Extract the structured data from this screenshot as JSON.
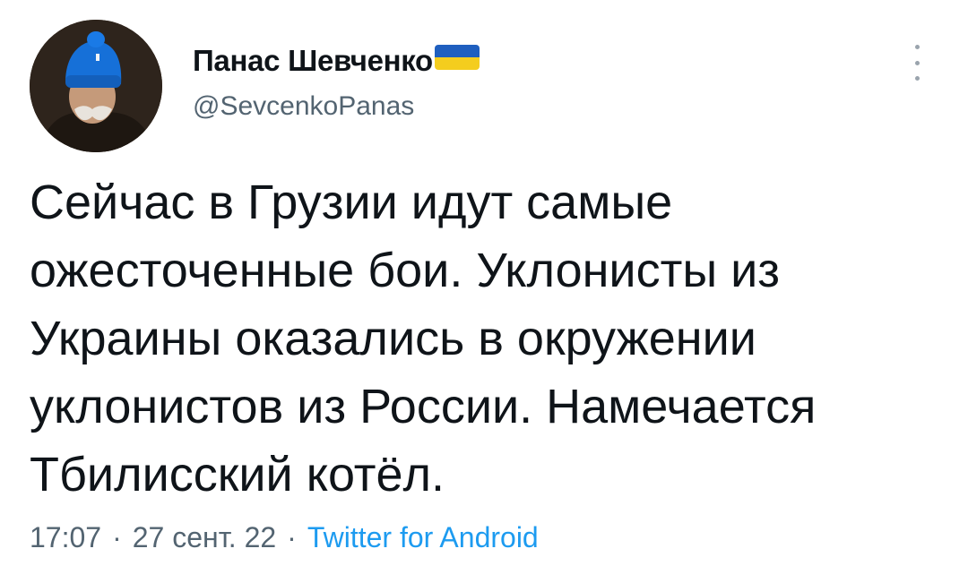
{
  "author": {
    "display_name": "Панас Шевченко",
    "handle": "@SevcenkoPanas",
    "flag_colors": {
      "top": "#1f5fbf",
      "bottom": "#f4cd1e"
    }
  },
  "tweet": {
    "lines": [
      "Сейчас в Грузии идут самые",
      "ожесточенные бои. Уклонисты из",
      "Украины оказались в окружении",
      "уклонистов из России. Намечается",
      "Тбилисский котёл."
    ]
  },
  "meta": {
    "time": "17:07",
    "separator": "·",
    "date": "27 сент. 22",
    "source": "Twitter for Android"
  },
  "colors": {
    "text": "#0f1419",
    "secondary": "#536471",
    "link": "#1d9bf0"
  },
  "icons": {
    "more": "more-vertical-icon",
    "avatar": "avatar-portrait"
  }
}
